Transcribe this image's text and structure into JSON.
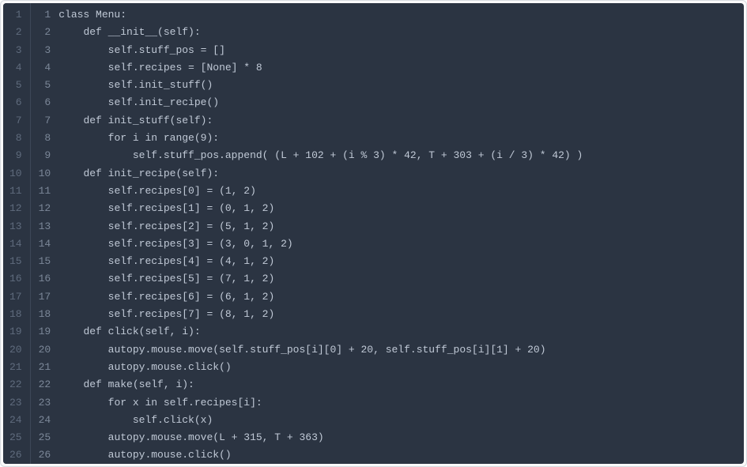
{
  "editor": {
    "lines": [
      {
        "outer": "1",
        "inner": "1",
        "indent": 0,
        "code": "class Menu:"
      },
      {
        "outer": "2",
        "inner": "2",
        "indent": 1,
        "code": "def __init__(self):"
      },
      {
        "outer": "3",
        "inner": "3",
        "indent": 2,
        "code": "self.stuff_pos = []"
      },
      {
        "outer": "4",
        "inner": "4",
        "indent": 2,
        "code": "self.recipes = [None] * 8"
      },
      {
        "outer": "5",
        "inner": "5",
        "indent": 2,
        "code": "self.init_stuff()"
      },
      {
        "outer": "6",
        "inner": "6",
        "indent": 2,
        "code": "self.init_recipe()"
      },
      {
        "outer": "7",
        "inner": "7",
        "indent": 1,
        "code": "def init_stuff(self):"
      },
      {
        "outer": "8",
        "inner": "8",
        "indent": 2,
        "code": "for i in range(9):"
      },
      {
        "outer": "9",
        "inner": "9",
        "indent": 3,
        "code": "self.stuff_pos.append( (L + 102 + (i % 3) * 42, T + 303 + (i / 3) * 42) )"
      },
      {
        "outer": "10",
        "inner": "10",
        "indent": 1,
        "code": "def init_recipe(self):"
      },
      {
        "outer": "11",
        "inner": "11",
        "indent": 2,
        "code": "self.recipes[0] = (1, 2)"
      },
      {
        "outer": "12",
        "inner": "12",
        "indent": 2,
        "code": "self.recipes[1] = (0, 1, 2)"
      },
      {
        "outer": "13",
        "inner": "13",
        "indent": 2,
        "code": "self.recipes[2] = (5, 1, 2)"
      },
      {
        "outer": "14",
        "inner": "14",
        "indent": 2,
        "code": "self.recipes[3] = (3, 0, 1, 2)"
      },
      {
        "outer": "15",
        "inner": "15",
        "indent": 2,
        "code": "self.recipes[4] = (4, 1, 2)"
      },
      {
        "outer": "16",
        "inner": "16",
        "indent": 2,
        "code": "self.recipes[5] = (7, 1, 2)"
      },
      {
        "outer": "17",
        "inner": "17",
        "indent": 2,
        "code": "self.recipes[6] = (6, 1, 2)"
      },
      {
        "outer": "18",
        "inner": "18",
        "indent": 2,
        "code": "self.recipes[7] = (8, 1, 2)"
      },
      {
        "outer": "19",
        "inner": "19",
        "indent": 1,
        "code": "def click(self, i):"
      },
      {
        "outer": "20",
        "inner": "20",
        "indent": 2,
        "code": "autopy.mouse.move(self.stuff_pos[i][0] + 20, self.stuff_pos[i][1] + 20)"
      },
      {
        "outer": "21",
        "inner": "21",
        "indent": 2,
        "code": "autopy.mouse.click()"
      },
      {
        "outer": "22",
        "inner": "22",
        "indent": 1,
        "code": "def make(self, i):"
      },
      {
        "outer": "23",
        "inner": "23",
        "indent": 2,
        "code": "for x in self.recipes[i]:"
      },
      {
        "outer": "24",
        "inner": "24",
        "indent": 3,
        "code": "self.click(x)"
      },
      {
        "outer": "25",
        "inner": "25",
        "indent": 2,
        "code": "autopy.mouse.move(L + 315, T + 363)"
      },
      {
        "outer": "26",
        "inner": "26",
        "indent": 2,
        "code": "autopy.mouse.click()"
      }
    ],
    "indent_unit": "    "
  },
  "colors": {
    "editor_bg": "#2b3442",
    "gutter_fg": "#5f6b7d",
    "gutter_border": "#3d4757",
    "inner_gutter_fg": "#7b8798",
    "code_fg": "#c0c9d6",
    "frame_border": "#d7dbe0"
  }
}
